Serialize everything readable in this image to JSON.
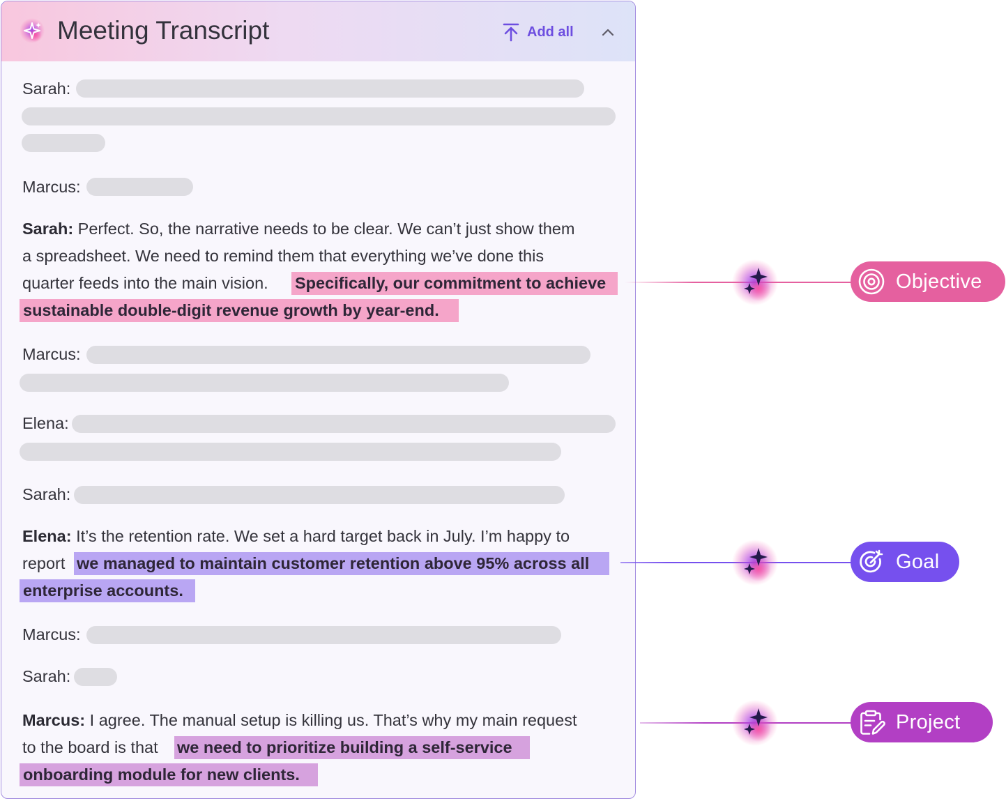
{
  "header": {
    "title": "Meeting Transcript",
    "add_all_label": "Add all"
  },
  "transcript": {
    "speaker_sarah": "Sarah:",
    "speaker_marcus": "Marcus:",
    "speaker_elena": "Elena:",
    "sarah_block": {
      "speaker": "Sarah:",
      "line1": "Perfect. So, the narrative needs to be clear. We can’t just show them",
      "line2": "a spreadsheet. We need to remind them that everything we’ve done this",
      "line3": "quarter feeds into the main vision.",
      "highlight1": "Specifically, our commitment to achieve",
      "highlight2": "sustainable double-digit revenue growth by year-end."
    },
    "elena_block": {
      "speaker": "Elena:",
      "line1": "It’s the retention rate. We set a hard target back in July. I’m happy to",
      "line2": "report",
      "highlight1": "we managed to maintain customer retention above 95% across all",
      "highlight2": "enterprise accounts."
    },
    "marcus_block": {
      "speaker": "Marcus:",
      "line1": "I agree. The manual setup is killing us. That’s why my main request",
      "line2": "to the board is that",
      "highlight1": "we need to prioritize building a self-service",
      "highlight2": "onboarding module for new clients."
    }
  },
  "tags": {
    "objective": {
      "label": "Objective",
      "icon": "target-icon",
      "color": "#e5609f"
    },
    "goal": {
      "label": "Goal",
      "icon": "target-arrow-icon",
      "color": "#7650ee"
    },
    "project": {
      "label": "Project",
      "icon": "clipboard-edit-icon",
      "color": "#b23fc4"
    }
  },
  "colors": {
    "highlight_objective": "#f5a5c9",
    "highlight_goal": "#b9a6f3",
    "highlight_project": "#d6a2de",
    "accent": "#6d4ee0"
  }
}
